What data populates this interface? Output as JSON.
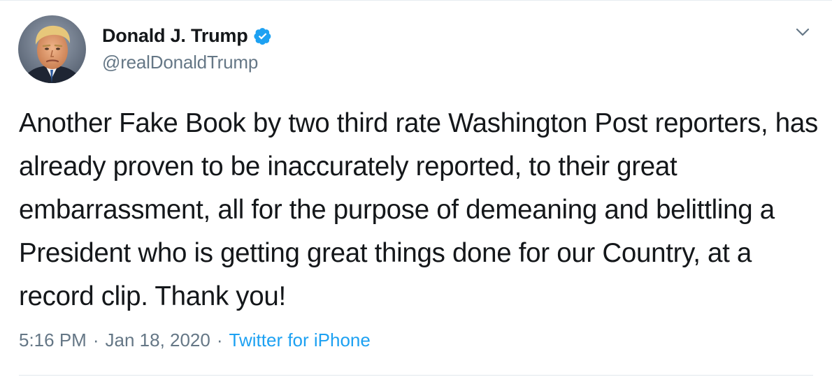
{
  "author": {
    "display_name": "Donald J. Trump",
    "handle": "@realDonaldTrump",
    "verified": true
  },
  "tweet": {
    "text": "Another Fake Book by two third rate Washington Post reporters, has already proven to be inaccurately reported, to their great embarrassment, all for the purpose of demeaning and belittling a President who is getting great things done for our Country, at a record clip. Thank you!",
    "time": "5:16 PM",
    "date": "Jan 18, 2020",
    "separator": "·",
    "source": "Twitter for iPhone"
  },
  "icons": {
    "verified": "verified-badge-icon",
    "more": "chevron-down-icon",
    "avatar": "profile-photo"
  },
  "colors": {
    "text": "#14171a",
    "secondary": "#657786",
    "link": "#1da1f2",
    "verified": "#1da1f2"
  }
}
